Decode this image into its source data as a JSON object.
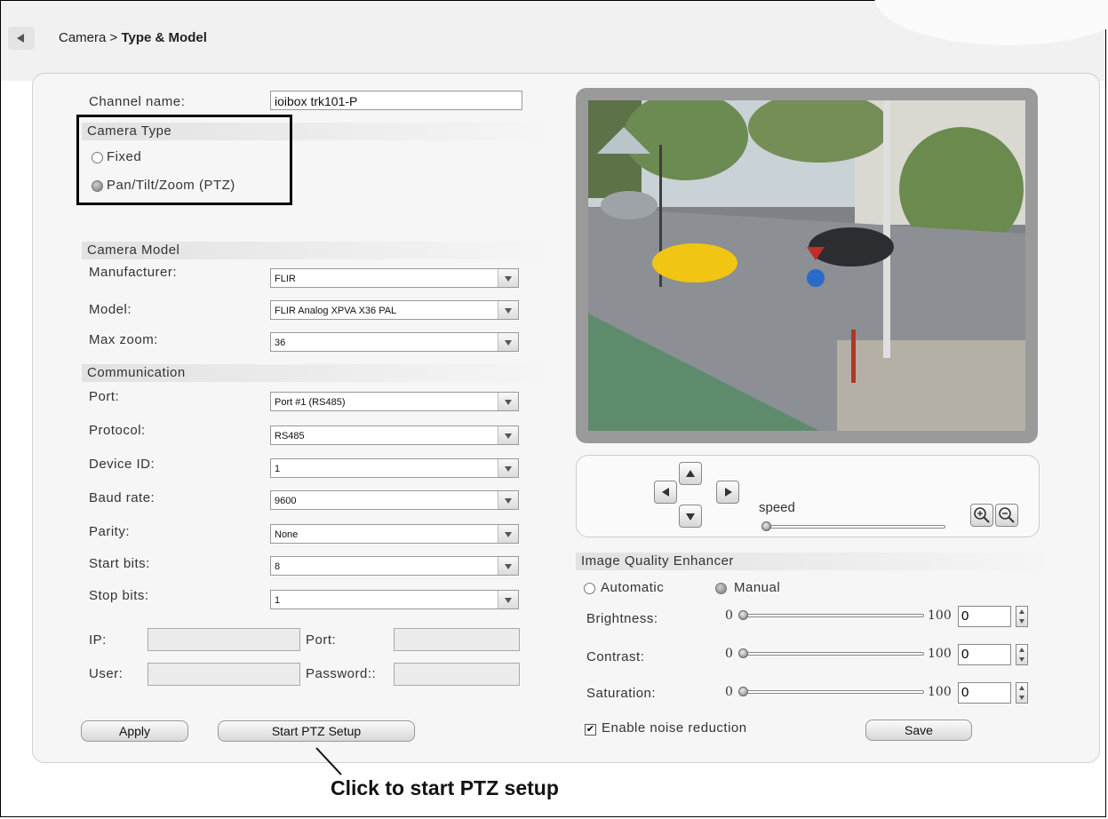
{
  "breadcrumb": {
    "parent": "Camera",
    "separator": " > ",
    "current": "Type & Model"
  },
  "channel": {
    "label": "Channel name:",
    "value": "ioibox trk101-P"
  },
  "camera_type": {
    "title": "Camera Type",
    "options": [
      {
        "label": "Fixed",
        "selected": false
      },
      {
        "label": "Pan/Tilt/Zoom (PTZ)",
        "selected": true
      }
    ]
  },
  "camera_model": {
    "title": "Camera Model",
    "manufacturer": {
      "label": "Manufacturer:",
      "value": "FLIR"
    },
    "model": {
      "label": "Model:",
      "value": "FLIR Analog XPVA X36 PAL"
    },
    "max_zoom": {
      "label": "Max zoom:",
      "value": "36"
    }
  },
  "communication": {
    "title": "Communication",
    "port": {
      "label": "Port:",
      "value": "Port #1 (RS485)"
    },
    "protocol": {
      "label": "Protocol:",
      "value": "RS485"
    },
    "device_id": {
      "label": "Device ID:",
      "value": "1"
    },
    "baud_rate": {
      "label": "Baud rate:",
      "value": "9600"
    },
    "parity": {
      "label": "Parity:",
      "value": "None"
    },
    "start_bits": {
      "label": "Start bits:",
      "value": "8"
    },
    "stop_bits": {
      "label": "Stop bits:",
      "value": "1"
    },
    "ip_label": "IP:",
    "ip_port_label": "Port:",
    "user_label": "User:",
    "password_label": "Password::"
  },
  "buttons": {
    "apply": "Apply",
    "start_ptz": "Start PTZ Setup",
    "save": "Save"
  },
  "ptz_controls": {
    "speed_label": "speed",
    "speed_value": 0
  },
  "image_quality": {
    "title": "Image Quality Enhancer",
    "modes": [
      {
        "label": "Automatic",
        "selected": false
      },
      {
        "label": "Manual",
        "selected": true
      }
    ],
    "brightness": {
      "label": "Brightness:",
      "min": "0",
      "max": "100",
      "value": "0"
    },
    "contrast": {
      "label": "Contrast:",
      "min": "0",
      "max": "100",
      "value": "0"
    },
    "saturation": {
      "label": "Saturation:",
      "min": "0",
      "max": "100",
      "value": "0"
    },
    "noise_reduction": {
      "label": "Enable noise reduction",
      "checked": true
    }
  },
  "annotation": {
    "text": "Click to start PTZ setup"
  },
  "colors": {
    "accent_gray": "#9a9a9a",
    "panel_bg": "#f6f6f6"
  }
}
